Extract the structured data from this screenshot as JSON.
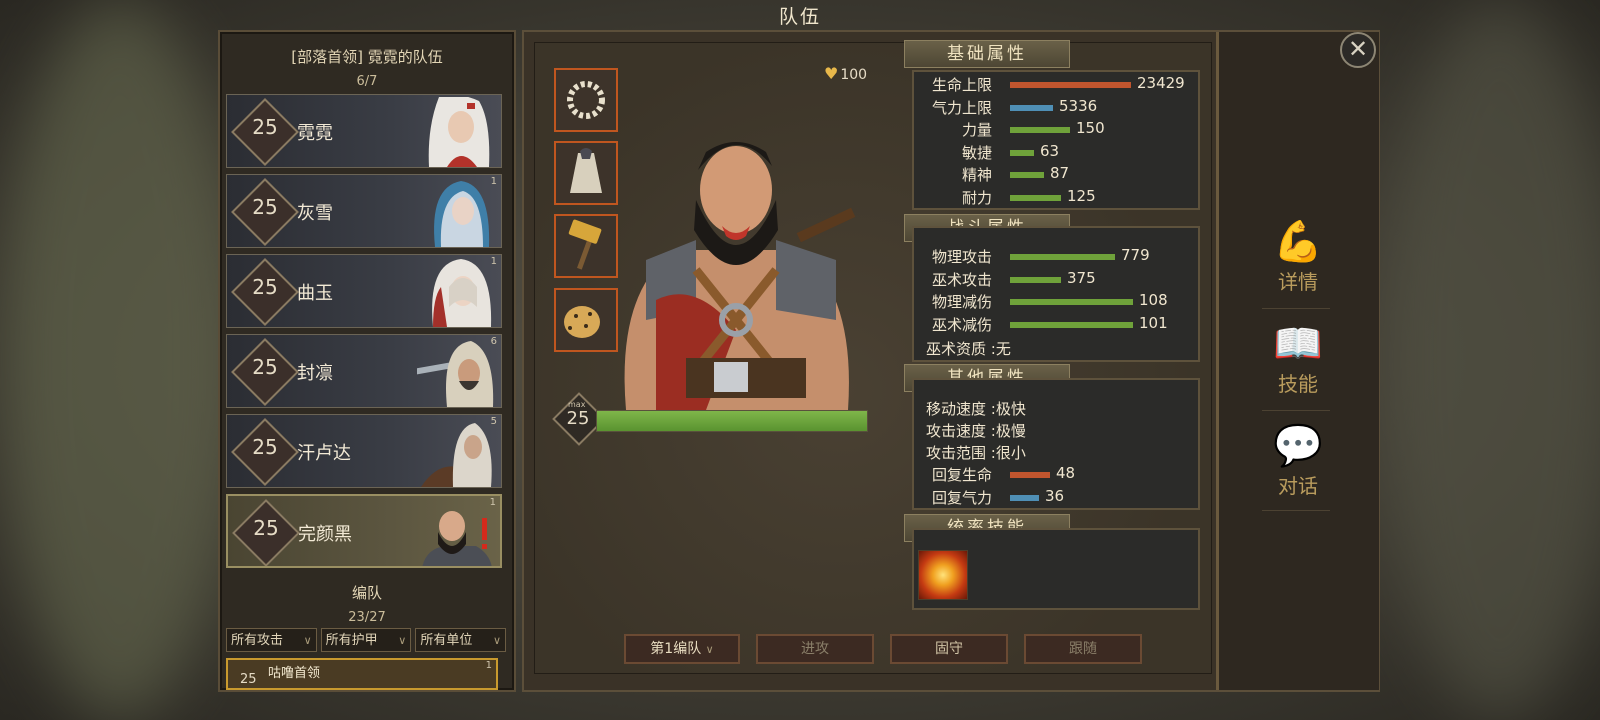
{
  "window_title": "队伍",
  "team": {
    "title": "[部落首领] 霓霓的队伍",
    "count": "6/7",
    "heroes": [
      {
        "level": "25",
        "name": "霓霓",
        "badge": ""
      },
      {
        "level": "25",
        "name": "灰雪",
        "badge": "1"
      },
      {
        "level": "25",
        "name": "曲玉",
        "badge": "1"
      },
      {
        "level": "25",
        "name": "封凛",
        "badge": "6"
      },
      {
        "level": "25",
        "name": "汗卢达",
        "badge": "5"
      },
      {
        "level": "25",
        "name": "完颜黑",
        "badge": "1"
      }
    ]
  },
  "formation": {
    "title": "编队",
    "count": "23/27",
    "filters": [
      "所有攻击",
      "所有护甲",
      "所有单位"
    ],
    "unit": {
      "level": "25",
      "name": "咕噜首领",
      "badge": "1"
    }
  },
  "hero_detail": {
    "gold": "100",
    "level": "25",
    "level_max_label": "max",
    "xp_fraction": 1.0
  },
  "basic_attrs": {
    "header": "基础属性",
    "rows": [
      {
        "label": "生命上限",
        "value": "23429",
        "color": "#c0552e",
        "fraction": 0.9
      },
      {
        "label": "气力上限",
        "value": "5336",
        "color": "#4f8fb5",
        "fraction": 0.32
      },
      {
        "label": "力量",
        "value": "150",
        "color": "#6fa23a",
        "fraction": 0.45
      },
      {
        "label": "敏捷",
        "value": "63",
        "color": "#6fa23a",
        "fraction": 0.18
      },
      {
        "label": "精神",
        "value": "87",
        "color": "#6fa23a",
        "fraction": 0.25
      },
      {
        "label": "耐力",
        "value": "125",
        "color": "#6fa23a",
        "fraction": 0.38
      }
    ]
  },
  "combat_attrs": {
    "header": "战斗属性",
    "rows": [
      {
        "label": "物理攻击",
        "value": "779",
        "color": "#6fa23a",
        "fraction": 0.78
      },
      {
        "label": "巫术攻击",
        "value": "375",
        "color": "#6fa23a",
        "fraction": 0.38
      },
      {
        "label": "物理减伤",
        "value": "108",
        "color": "#6fa23a",
        "fraction": 0.92
      },
      {
        "label": "巫术减伤",
        "value": "101",
        "color": "#6fa23a",
        "fraction": 0.92
      }
    ],
    "aptitude": "巫术资质 :无"
  },
  "other_attrs": {
    "header": "其他属性",
    "texts": [
      "移动速度 :极快",
      "攻击速度 :极慢",
      "攻击范围 :很小"
    ],
    "rows": [
      {
        "label": "回复生命",
        "value": "48",
        "color": "#c0552e",
        "fraction": 0.3
      },
      {
        "label": "回复气力",
        "value": "36",
        "color": "#4f8fb5",
        "fraction": 0.22
      }
    ]
  },
  "leadership": {
    "header": "统率技能"
  },
  "bottom": {
    "squad_select": "第1编队",
    "attack": "进攻",
    "hold": "固守",
    "follow": "跟随"
  },
  "rail": {
    "details": "详情",
    "skills": "技能",
    "dialogue": "对话"
  }
}
